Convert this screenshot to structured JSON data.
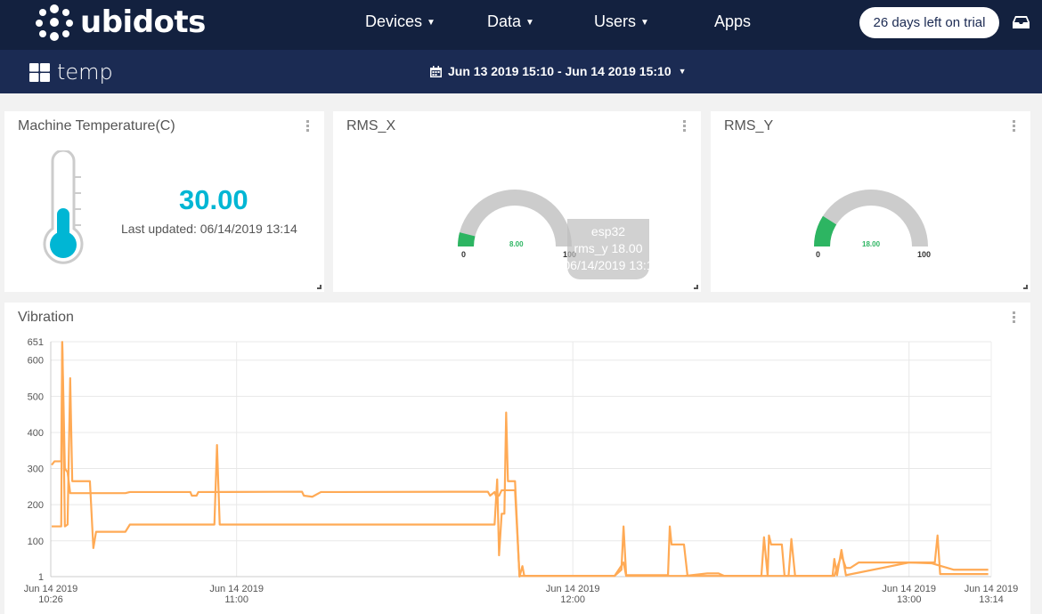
{
  "nav": {
    "brand": "ubidots",
    "items": [
      {
        "label": "Devices",
        "dropdown": true
      },
      {
        "label": "Data",
        "dropdown": true
      },
      {
        "label": "Users",
        "dropdown": true
      },
      {
        "label": "Apps",
        "dropdown": false
      }
    ],
    "trial": "26 days left on trial",
    "inbox_icon": "inbox-icon"
  },
  "dashboard": {
    "title": "temp",
    "icon": "dashboard-grid-icon",
    "date_range": "Jun 13 2019 15:10 - Jun 14 2019 15:10",
    "calendar_icon": "calendar-icon"
  },
  "widgets": {
    "temperature": {
      "title": "Machine Temperature(C)",
      "value": "30.00",
      "updated": "Last updated: 06/14/2019 13:14",
      "icon": "thermometer-icon",
      "accent": "#00b6d4",
      "level": 0.45
    },
    "rms_x": {
      "title": "RMS_X",
      "value": 8,
      "value_label": "8.00",
      "min": "0",
      "max": "100",
      "color": "#2db562",
      "tooltip": {
        "device": "esp32",
        "line": "rms_y 18.00",
        "time": "06/14/2019 13:1"
      }
    },
    "rms_y": {
      "title": "RMS_Y",
      "value": 18,
      "value_label": "18.00",
      "min": "0",
      "max": "100",
      "color": "#2db562"
    }
  },
  "vibration": {
    "title": "Vibration"
  },
  "chart_data": {
    "type": "line",
    "title": "Vibration",
    "color": "#ffaa55",
    "grid": true,
    "xlim": [
      "10:26:50",
      "13:14:40"
    ],
    "ylim": [
      1,
      651
    ],
    "yticks": [
      1,
      100,
      200,
      300,
      400,
      500,
      600,
      651
    ],
    "xticks": [
      {
        "t": "10:26:50",
        "l1": "Jun 14 2019",
        "l2": "10:26"
      },
      {
        "t": "11:00:00",
        "l1": "Jun 14 2019",
        "l2": "11:00"
      },
      {
        "t": "12:00:00",
        "l1": "Jun 14 2019",
        "l2": "12:00"
      },
      {
        "t": "13:00:00",
        "l1": "Jun 14 2019",
        "l2": "13:00"
      },
      {
        "t": "13:14:40",
        "l1": "Jun 14 2019",
        "l2": "13:14"
      }
    ],
    "series": [
      {
        "points": [
          [
            "10:27:00",
            310
          ],
          [
            "10:27:30",
            320
          ],
          [
            "10:28:42",
            320
          ],
          [
            "10:28:53",
            650
          ],
          [
            "10:29:21",
            300
          ],
          [
            "10:29:50",
            290
          ],
          [
            "10:30:18",
            232
          ],
          [
            "10:40:09",
            232
          ],
          [
            "10:40:57",
            235
          ],
          [
            "10:51:45",
            235
          ],
          [
            "10:52:00",
            225
          ],
          [
            "10:52:51",
            225
          ],
          [
            "10:53:10",
            235
          ],
          [
            "11:11:40",
            236
          ],
          [
            "11:12:00",
            225
          ],
          [
            "11:13:30",
            222
          ],
          [
            "11:15:03",
            235
          ],
          [
            "11:44:50",
            236
          ],
          [
            "11:45:14",
            225
          ],
          [
            "11:46:02",
            235
          ],
          [
            "11:46:20",
            222
          ],
          [
            "11:46:50",
            225
          ],
          [
            "11:47:18",
            240
          ],
          [
            "11:49:41",
            240
          ],
          [
            "11:50:29",
            3
          ],
          [
            "12:07:27",
            3
          ],
          [
            "12:09:03",
            40
          ],
          [
            "12:09:31",
            3
          ],
          [
            "12:20:00",
            3
          ],
          [
            "12:24:00",
            10
          ],
          [
            "12:26:00",
            10
          ],
          [
            "12:27:00",
            3
          ],
          [
            "12:46:40",
            3
          ],
          [
            "12:47:56",
            60
          ],
          [
            "12:48:44",
            25
          ],
          [
            "12:49:31",
            25
          ],
          [
            "12:51:00",
            40
          ],
          [
            "13:00:00",
            40
          ],
          [
            "13:04:00",
            38
          ],
          [
            "13:08:00",
            20
          ],
          [
            "13:14:08",
            20
          ]
        ]
      },
      {
        "points": [
          [
            "10:27:00",
            140
          ],
          [
            "10:28:42",
            140
          ],
          [
            "10:28:53",
            650
          ],
          [
            "10:29:21",
            140
          ],
          [
            "10:29:50",
            145
          ],
          [
            "10:30:18",
            550
          ],
          [
            "10:30:40",
            265
          ],
          [
            "10:33:49",
            265
          ],
          [
            "10:34:26",
            80
          ],
          [
            "10:34:55",
            125
          ],
          [
            "10:40:09",
            125
          ],
          [
            "10:40:57",
            145
          ],
          [
            "10:56:02",
            145
          ],
          [
            "10:56:30",
            365
          ],
          [
            "10:56:59",
            145
          ],
          [
            "11:46:02",
            145
          ],
          [
            "11:46:30",
            270
          ],
          [
            "11:46:50",
            60
          ],
          [
            "11:47:18",
            175
          ],
          [
            "11:47:47",
            175
          ],
          [
            "11:48:06",
            455
          ],
          [
            "11:48:25",
            265
          ],
          [
            "11:49:41",
            265
          ],
          [
            "11:50:29",
            1
          ],
          [
            "11:51:00",
            30
          ],
          [
            "11:51:20",
            3
          ],
          [
            "12:07:27",
            3
          ],
          [
            "12:08:40",
            20
          ],
          [
            "12:09:03",
            140
          ],
          [
            "12:09:31",
            5
          ],
          [
            "12:16:59",
            5
          ],
          [
            "12:17:18",
            140
          ],
          [
            "12:17:37",
            90
          ],
          [
            "12:19:50",
            90
          ],
          [
            "12:20:28",
            3
          ],
          [
            "12:33:39",
            3
          ],
          [
            "12:34:07",
            110
          ],
          [
            "12:34:46",
            3
          ],
          [
            "12:35:00",
            115
          ],
          [
            "12:35:23",
            90
          ],
          [
            "12:37:18",
            90
          ],
          [
            "12:37:47",
            3
          ],
          [
            "12:38:30",
            3
          ],
          [
            "12:39:00",
            105
          ],
          [
            "12:39:40",
            3
          ],
          [
            "12:46:21",
            3
          ],
          [
            "12:46:40",
            50
          ],
          [
            "12:47:09",
            5
          ],
          [
            "12:47:56",
            75
          ],
          [
            "12:48:44",
            5
          ],
          [
            "13:00:00",
            40
          ],
          [
            "13:04:36",
            40
          ],
          [
            "13:05:05",
            115
          ],
          [
            "13:05:33",
            8
          ],
          [
            "13:14:08",
            8
          ]
        ]
      }
    ]
  }
}
